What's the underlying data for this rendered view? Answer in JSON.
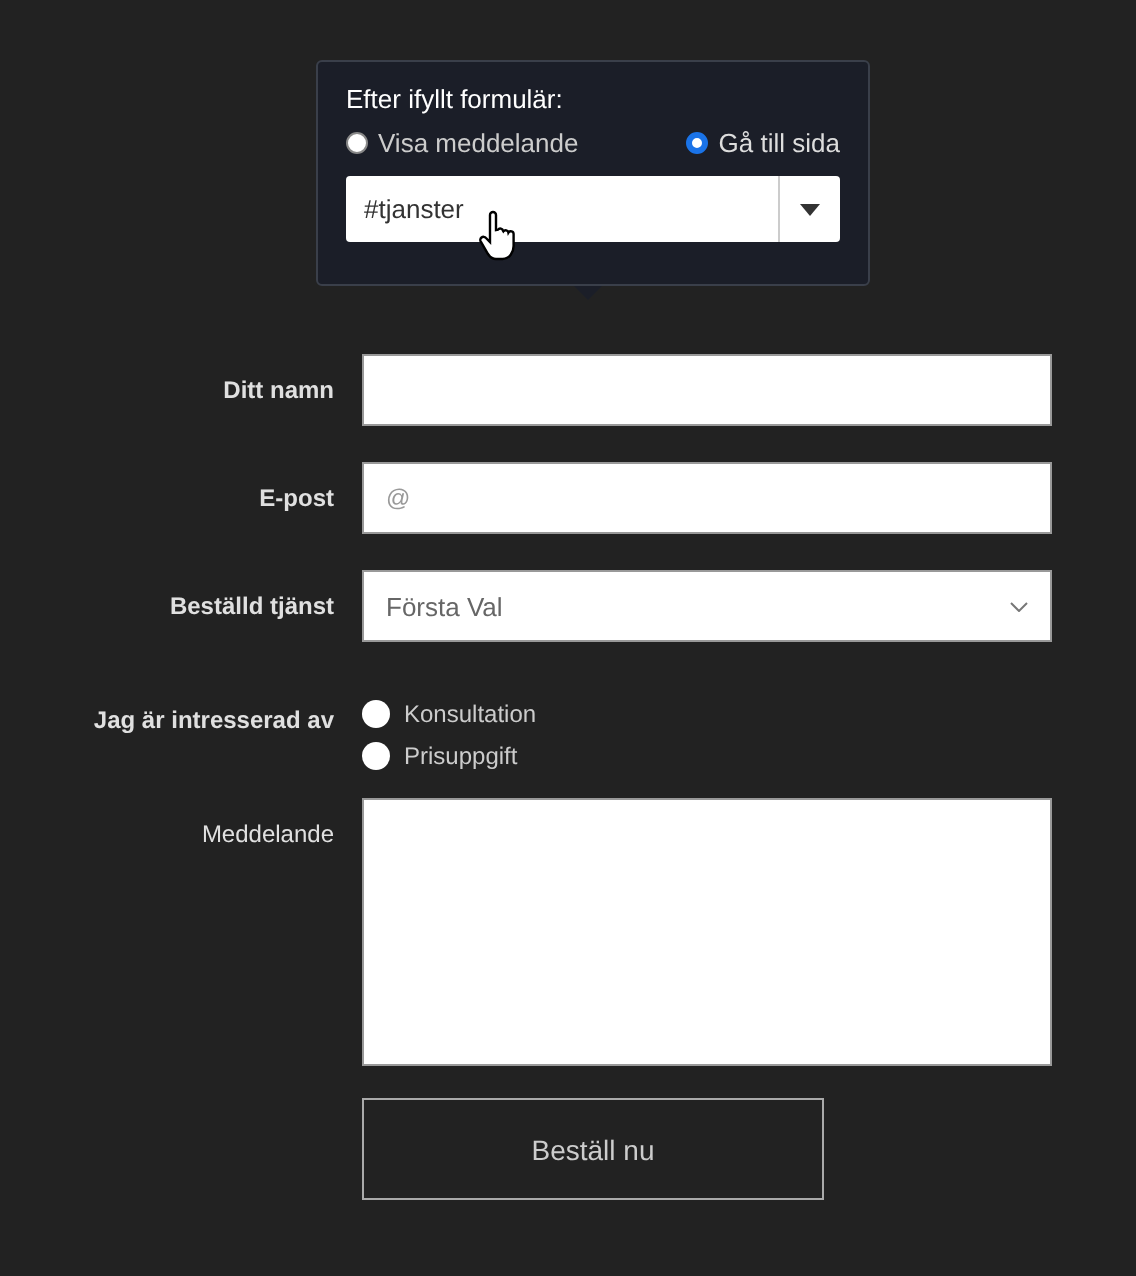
{
  "popover": {
    "title": "Efter ifyllt formulär:",
    "options": [
      {
        "label": "Visa meddelande",
        "selected": false
      },
      {
        "label": "Gå till sida",
        "selected": true
      }
    ],
    "page_select": {
      "value": "#tjanster"
    }
  },
  "form": {
    "fields": [
      {
        "kind": "text",
        "label": "Ditt namn",
        "bold": true
      },
      {
        "kind": "text",
        "label": "E-post",
        "bold": true,
        "placeholder": "@"
      },
      {
        "kind": "select",
        "label": "Beställd tjänst",
        "bold": true,
        "value": "Första Val"
      },
      {
        "kind": "radio",
        "label": "Jag är intresserad av",
        "bold": true,
        "options": [
          {
            "label": "Konsultation",
            "selected": false
          },
          {
            "label": "Prisuppgift",
            "selected": false
          }
        ]
      },
      {
        "kind": "textarea",
        "label": "Meddelande",
        "bold": false
      }
    ],
    "submit": "Beställ nu"
  }
}
